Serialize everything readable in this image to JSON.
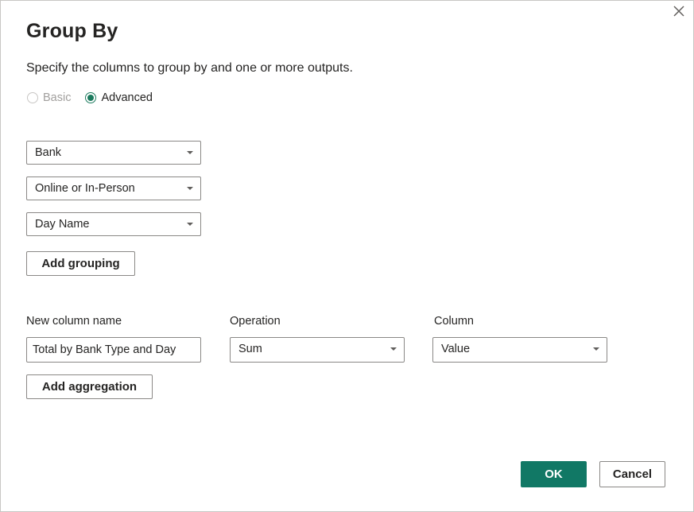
{
  "dialog": {
    "title": "Group By",
    "subtitle": "Specify the columns to group by and one or more outputs."
  },
  "mode": {
    "basic_label": "Basic",
    "advanced_label": "Advanced",
    "selected": "Advanced"
  },
  "grouping": {
    "columns": [
      "Bank",
      "Online or In-Person",
      "Day Name"
    ],
    "add_label": "Add grouping"
  },
  "aggregation": {
    "headers": {
      "new_column_name": "New column name",
      "operation": "Operation",
      "column": "Column"
    },
    "rows": [
      {
        "new_column_name": "Total by Bank Type and Day",
        "operation": "Sum",
        "column": "Value"
      }
    ],
    "add_label": "Add aggregation"
  },
  "footer": {
    "ok_label": "OK",
    "cancel_label": "Cancel"
  },
  "colors": {
    "accent": "#117865",
    "radio_selected": "#1b7a5d",
    "border": "#8a8886"
  },
  "icons": {
    "close": "close-icon",
    "dropdown": "chevron-down-icon"
  }
}
